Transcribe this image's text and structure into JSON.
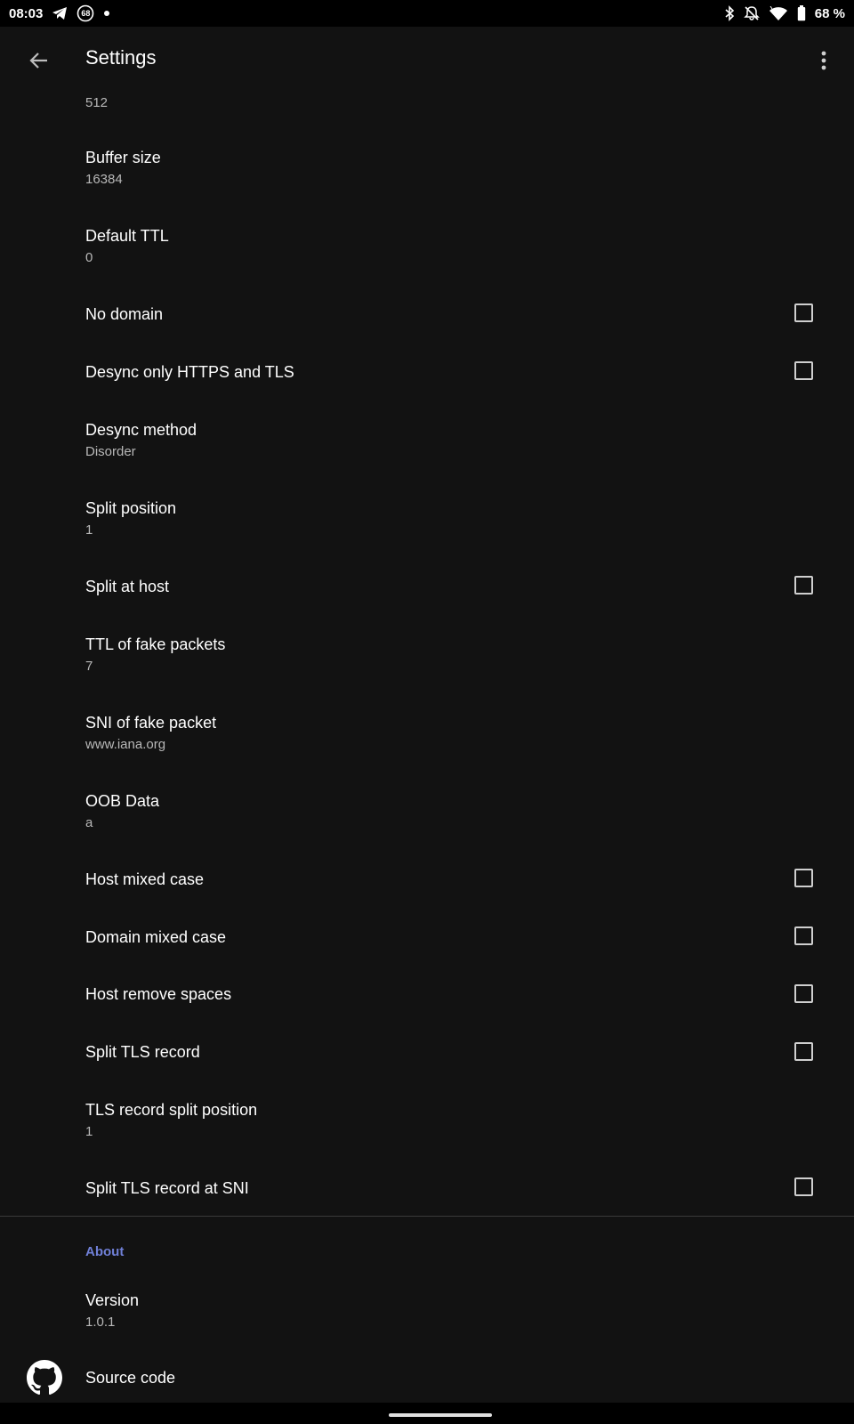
{
  "status_bar": {
    "time": "08:03",
    "badge_number": "68",
    "battery": "68 %",
    "icons": [
      "telegram-icon",
      "notification-badge-icon",
      "dot-icon",
      "bluetooth-icon",
      "mute-icon",
      "wifi-icon",
      "battery-icon"
    ]
  },
  "app_bar": {
    "title": "Settings",
    "back_icon": "arrow-back-icon",
    "menu_icon": "more-vert-icon"
  },
  "partial_item": {
    "summary": "512"
  },
  "settings": [
    {
      "title": "Buffer size",
      "summary": "16384"
    },
    {
      "title": "Default TTL",
      "summary": "0"
    },
    {
      "title": "No domain",
      "checked": false
    },
    {
      "title": "Desync only HTTPS and TLS",
      "checked": false
    },
    {
      "title": "Desync method",
      "summary": "Disorder"
    },
    {
      "title": "Split position",
      "summary": "1"
    },
    {
      "title": "Split at host",
      "checked": false
    },
    {
      "title": "TTL of fake packets",
      "summary": "7"
    },
    {
      "title": "SNI of fake packet",
      "summary": "www.iana.org"
    },
    {
      "title": "OOB Data",
      "summary": "a"
    },
    {
      "title": "Host mixed case",
      "checked": false
    },
    {
      "title": "Domain mixed case",
      "checked": false
    },
    {
      "title": "Host remove spaces",
      "checked": false
    },
    {
      "title": "Split TLS record",
      "checked": false
    },
    {
      "title": "TLS record split position",
      "summary": "1"
    },
    {
      "title": "Split TLS record at SNI",
      "checked": false
    }
  ],
  "about": {
    "category": "About",
    "version_title": "Version",
    "version_value": "1.0.1",
    "source_title": "Source code",
    "source_icon": "github-icon"
  },
  "colors": {
    "background": "#121212",
    "accent": "#6f7fd6",
    "secondary_text": "#b8b8b8"
  }
}
